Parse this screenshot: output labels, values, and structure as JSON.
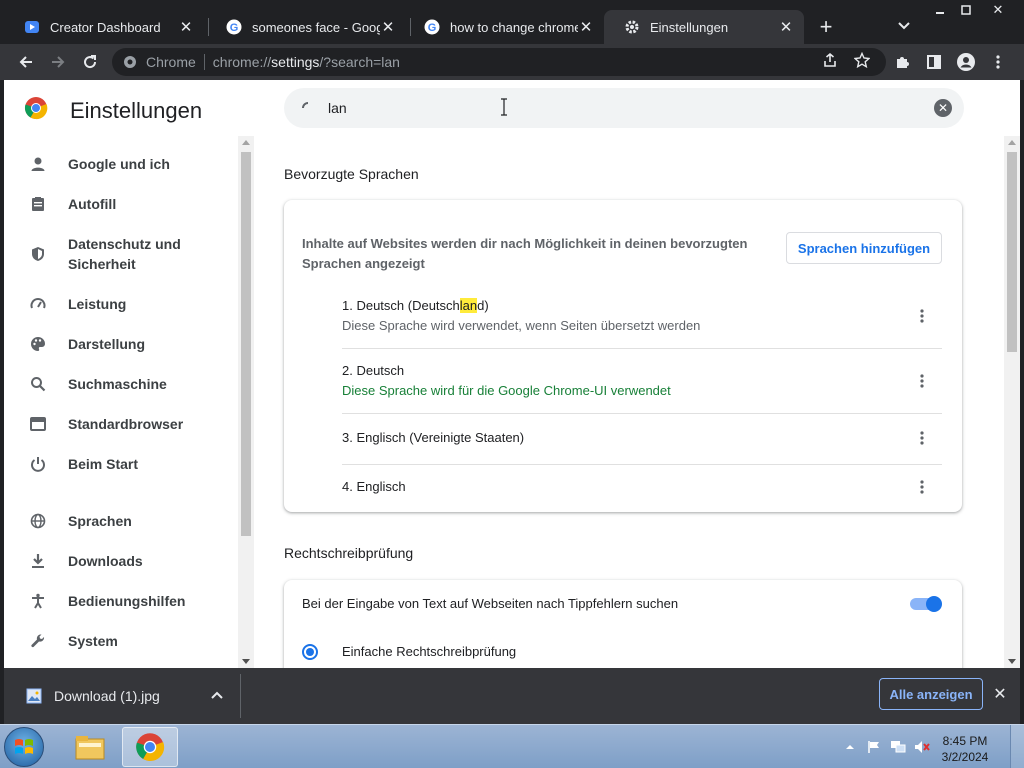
{
  "tabs": [
    {
      "title": "Creator Dashboard",
      "icon": "youtube-studio-icon"
    },
    {
      "title": "someones face - Google",
      "icon": "google-icon"
    },
    {
      "title": "how to change chrome la",
      "icon": "google-icon"
    },
    {
      "title": "Einstellungen",
      "icon": "settings-gear-icon"
    }
  ],
  "toolbar": {
    "chip": "Chrome",
    "url_scheme": "chrome://",
    "url_host": "settings",
    "url_path": "/?search=lan"
  },
  "settings": {
    "title": "Einstellungen",
    "search_value": "lan"
  },
  "sidebar": {
    "items": [
      {
        "label": "Google und ich",
        "icon": "person-icon"
      },
      {
        "label": "Autofill",
        "icon": "clipboard-icon"
      },
      {
        "label": "Datenschutz und Sicherheit",
        "icon": "shield-icon"
      },
      {
        "label": "Leistung",
        "icon": "speedometer-icon"
      },
      {
        "label": "Darstellung",
        "icon": "palette-icon"
      },
      {
        "label": "Suchmaschine",
        "icon": "search-icon"
      },
      {
        "label": "Standardbrowser",
        "icon": "browser-window-icon"
      },
      {
        "label": "Beim Start",
        "icon": "power-icon"
      },
      {
        "label": "Sprachen",
        "icon": "globe-icon"
      },
      {
        "label": "Downloads",
        "icon": "download-icon"
      },
      {
        "label": "Bedienungshilfen",
        "icon": "accessibility-icon"
      },
      {
        "label": "System",
        "icon": "wrench-icon"
      }
    ]
  },
  "languages": {
    "section_title": "Bevorzugte Sprachen",
    "description": "Inhalte auf Websites werden dir nach Möglichkeit in deinen bevorzugten Sprachen angezeigt",
    "add_button": "Sprachen hinzufügen",
    "entries": [
      {
        "name_pre": "1. Deutsch (Deutsch",
        "name_hl": "lan",
        "name_post": "d)",
        "sub": "Diese Sprache wird verwendet, wenn Seiten übersetzt werden"
      },
      {
        "name_pre": "2. Deutsch",
        "name_hl": "",
        "name_post": "",
        "sub": "Diese Sprache wird für die Google Chrome-UI verwendet"
      },
      {
        "name_pre": "3. Englisch (Vereinigte Staaten)",
        "name_hl": "",
        "name_post": "",
        "sub": ""
      },
      {
        "name_pre": "4. Englisch",
        "name_hl": "",
        "name_post": "",
        "sub": ""
      }
    ]
  },
  "spellcheck": {
    "section_title": "Rechtschreibprüfung",
    "toggle_label": "Bei der Eingabe von Text auf Webseiten nach Tippfehlern suchen",
    "toggle_on": true,
    "option_basic": "Einfache Rechtschreibprüfung"
  },
  "downloads": {
    "file_name": "Download (1).jpg",
    "show_all": "Alle anzeigen"
  },
  "taskbar": {
    "time": "8:45 PM",
    "date": "3/2/2024"
  },
  "colors": {
    "accent": "#1a73e8",
    "highlight": "#ffeb3b",
    "green_text": "#188038",
    "dark_frame": "#202124",
    "toolbar": "#35363a"
  }
}
